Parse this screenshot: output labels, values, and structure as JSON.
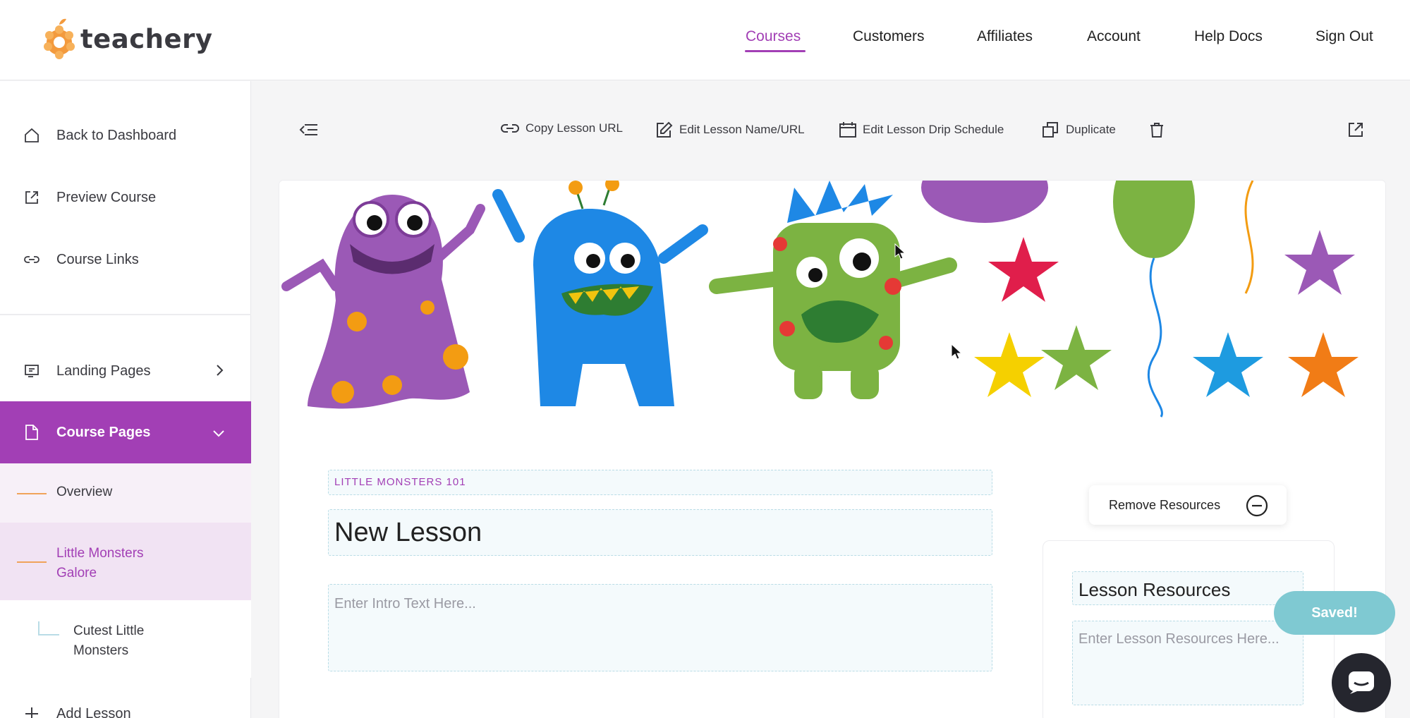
{
  "app": {
    "brand": "teachery",
    "accent_color": "#a23fb5",
    "logo_color": "#f39a3d"
  },
  "nav": {
    "items": [
      {
        "label": "Courses",
        "active": true
      },
      {
        "label": "Customers"
      },
      {
        "label": "Affiliates"
      },
      {
        "label": "Account"
      },
      {
        "label": "Help Docs"
      },
      {
        "label": "Sign Out"
      }
    ]
  },
  "sidebar": {
    "back": "Back to Dashboard",
    "preview": "Preview Course",
    "links": "Course Links",
    "landing": "Landing Pages",
    "course_pages": "Course Pages",
    "overview": "Overview",
    "module": "Little Monsters Galore",
    "lesson": "Cutest Little Monsters",
    "add_lesson": "Add Lesson"
  },
  "toolbar": {
    "copy_url": "Copy Lesson URL",
    "edit_name": "Edit Lesson Name/URL",
    "drip": "Edit Lesson Drip Schedule",
    "duplicate": "Duplicate"
  },
  "lesson": {
    "course_tag": "LITTLE MONSTERS 101",
    "title": "New Lesson",
    "intro_placeholder": "Enter Intro Text Here..."
  },
  "resources": {
    "remove_label": "Remove Resources",
    "heading": "Lesson Resources",
    "placeholder": "Enter Lesson Resources Here..."
  },
  "status": {
    "saved": "Saved!"
  }
}
